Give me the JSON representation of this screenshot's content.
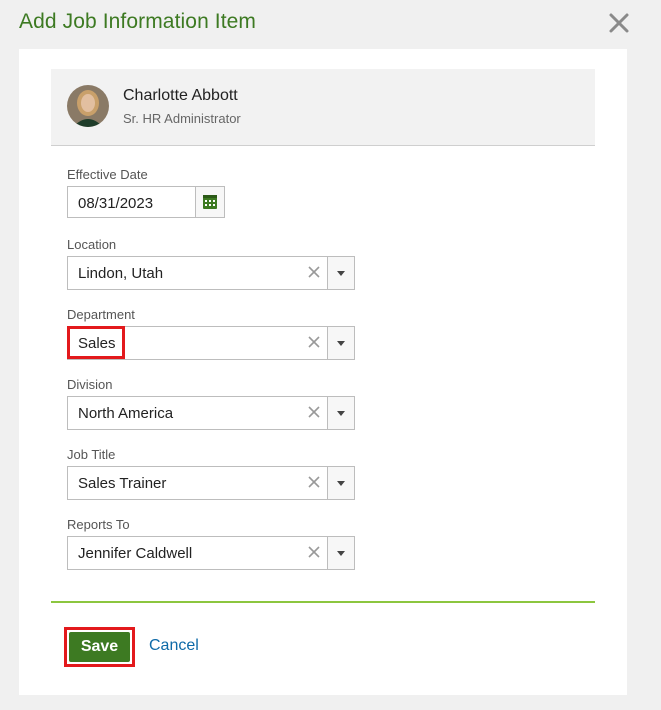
{
  "dialog": {
    "title": "Add Job Information Item"
  },
  "employee": {
    "name": "Charlotte Abbott",
    "role": "Sr. HR Administrator"
  },
  "fields": {
    "effective_date": {
      "label": "Effective Date",
      "value": "08/31/2023"
    },
    "location": {
      "label": "Location",
      "value": "Lindon, Utah"
    },
    "department": {
      "label": "Department",
      "value": "Sales"
    },
    "division": {
      "label": "Division",
      "value": "North America"
    },
    "job_title": {
      "label": "Job Title",
      "value": "Sales Trainer"
    },
    "reports_to": {
      "label": "Reports To",
      "value": "Jennifer Caldwell"
    }
  },
  "actions": {
    "save_label": "Save",
    "cancel_label": "Cancel"
  },
  "colors": {
    "brand_green": "#3d7a22",
    "divider_green": "#8cc63f",
    "link_blue": "#0e6aa8",
    "highlight_red": "#e3191c"
  },
  "icons": {
    "close": "close-icon",
    "calendar": "calendar-icon",
    "clear": "clear-x-icon",
    "dropdown": "chevron-down-icon"
  }
}
